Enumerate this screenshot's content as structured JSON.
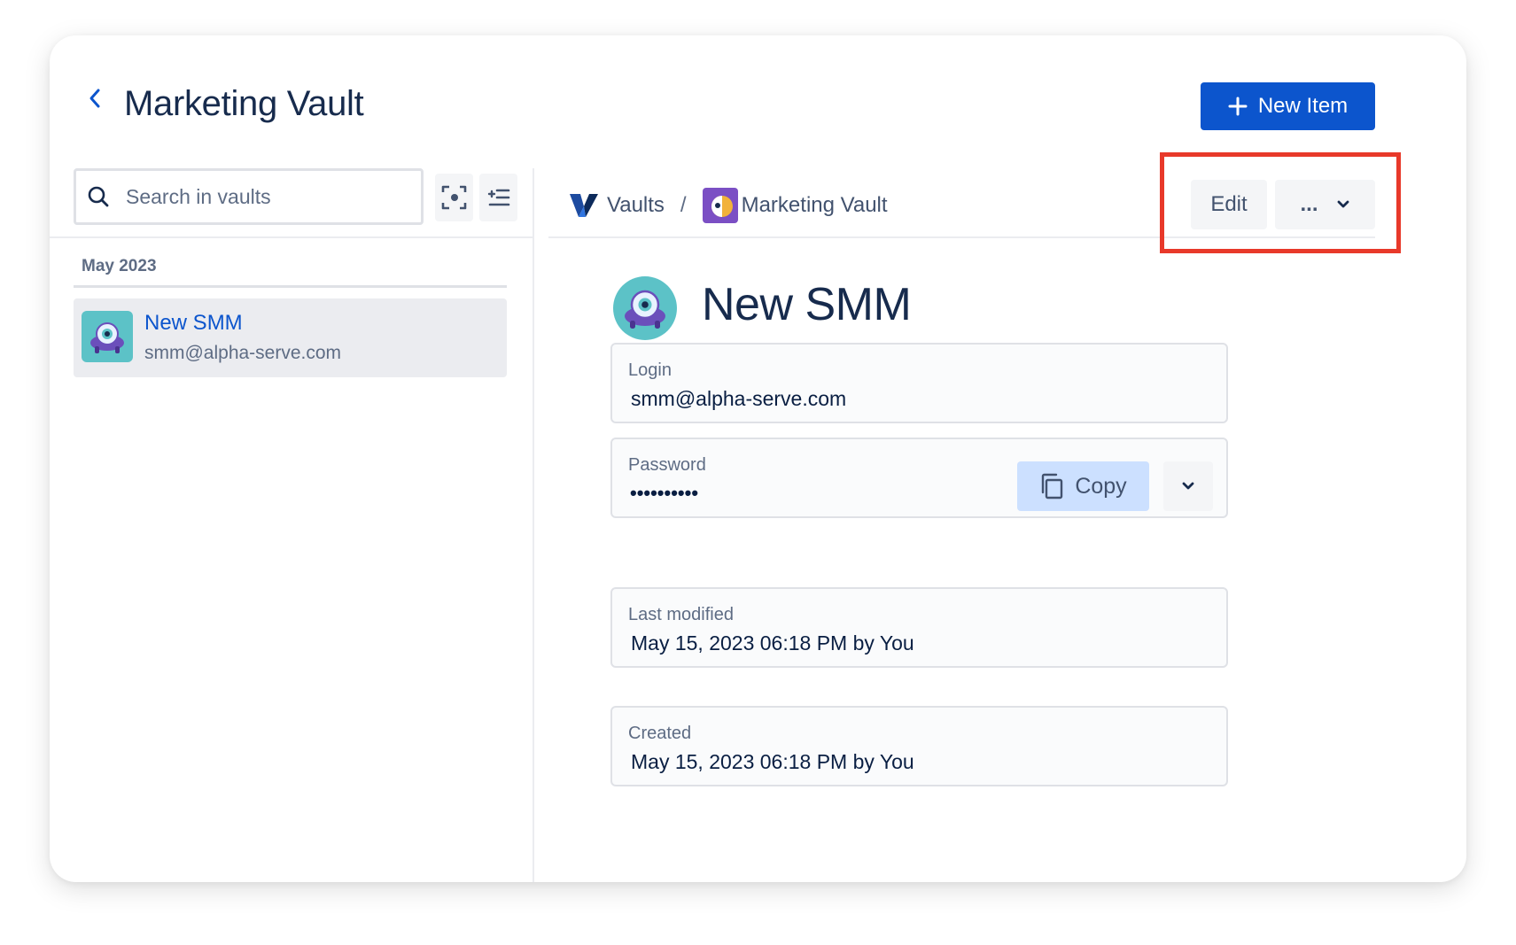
{
  "header": {
    "title": "Marketing Vault",
    "new_item_label": "New Item"
  },
  "sidebar": {
    "search_placeholder": "Search in vaults",
    "group_label": "May 2023",
    "items": [
      {
        "name": "New SMM",
        "subtitle": "smm@alpha-serve.com"
      }
    ]
  },
  "breadcrumb": {
    "root": "Vaults",
    "separator": "/",
    "current": "Marketing Vault"
  },
  "actions": {
    "edit_label": "Edit",
    "more_label": "..."
  },
  "item": {
    "title": "New SMM",
    "fields": {
      "login_label": "Login",
      "login_value": "smm@alpha-serve.com",
      "password_label": "Password",
      "password_value": "••••••••••",
      "copy_label": "Copy",
      "last_modified_label": "Last modified",
      "last_modified_value": "May 15, 2023 06:18 PM by You",
      "created_label": "Created",
      "created_value": "May 15, 2023 06:18 PM by You"
    }
  },
  "colors": {
    "primary": "#0c55cd",
    "highlight": "#e8392a",
    "copy_bg": "#cce0ff",
    "avatar_bg": "#5cc2c7",
    "avatar_purple": "#6b4fbb"
  },
  "icons": {
    "back": "chevron-left-icon",
    "plus": "plus-icon",
    "search": "search-icon",
    "focus": "focus-scan-icon",
    "filter": "list-filter-icon",
    "vaults_logo": "vaults-logo-icon",
    "vault": "vault-avatar-icon",
    "more_chevron": "chevron-down-icon",
    "copy": "copy-icon",
    "dropdown": "chevron-down-icon"
  }
}
